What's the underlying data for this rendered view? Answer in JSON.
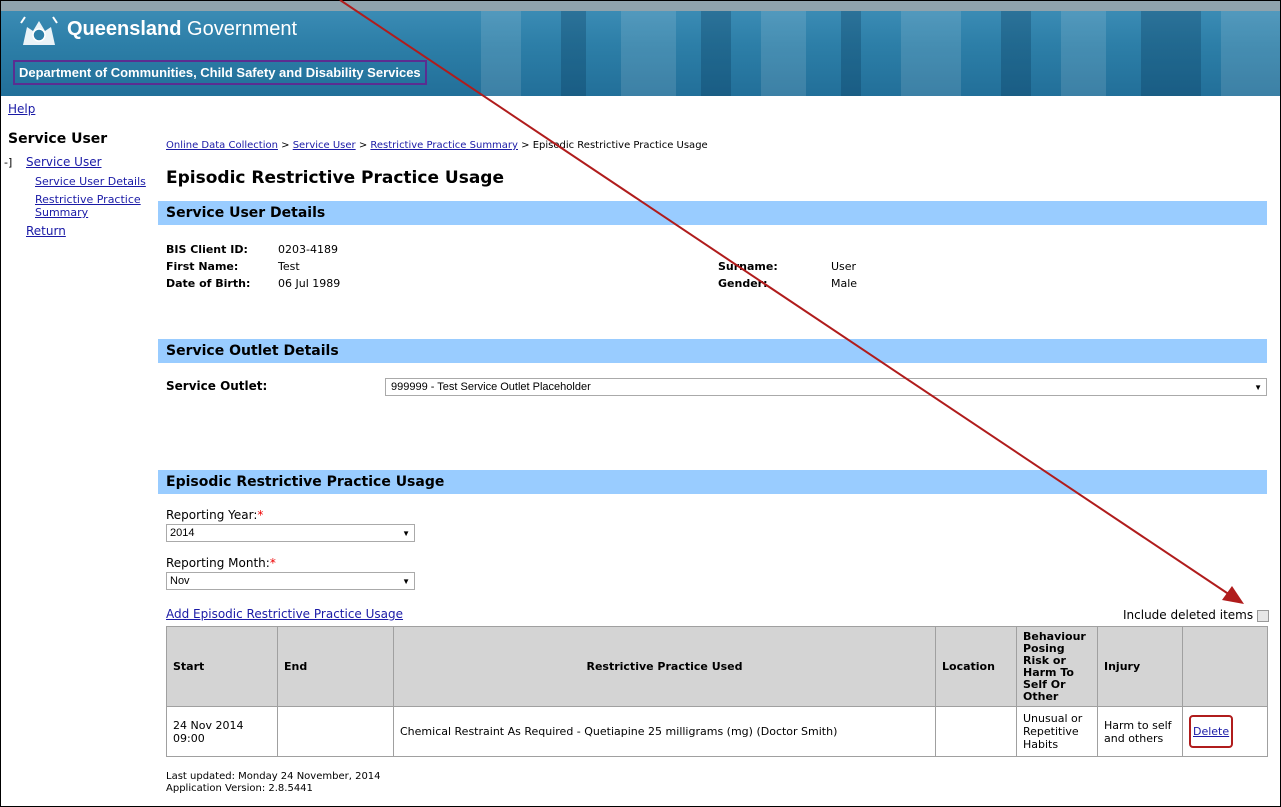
{
  "header": {
    "brand_bold": "Queensland",
    "brand_rest": " Government",
    "department": "Department of Communities, Child Safety and Disability Services"
  },
  "sidebar": {
    "help": "Help",
    "title": "Service User",
    "toggle": "-]",
    "items": [
      {
        "label": "Service User"
      },
      {
        "label": "Service User Details"
      },
      {
        "label": "Restrictive Practice Summary"
      },
      {
        "label": "Return"
      }
    ]
  },
  "breadcrumb": {
    "items": [
      "Online Data Collection",
      "Service User",
      "Restrictive Practice Summary"
    ],
    "separator": " > ",
    "current": "Episodic Restrictive Practice Usage"
  },
  "page_title": "Episodic Restrictive Practice Usage",
  "service_user_details": {
    "heading": "Service User Details",
    "bis_label": "BIS Client ID:",
    "bis_value": "0203-4189",
    "first_label": "First Name:",
    "first_value": "Test",
    "surname_label": "Surname:",
    "surname_value": "User",
    "dob_label": "Date of Birth:",
    "dob_value": "06 Jul 1989",
    "gender_label": "Gender:",
    "gender_value": "Male"
  },
  "service_outlet": {
    "heading": "Service Outlet Details",
    "label": "Service Outlet:",
    "value": "999999 - Test Service Outlet Placeholder"
  },
  "usage": {
    "heading": "Episodic Restrictive Practice Usage",
    "year_label": "Reporting Year:",
    "year_value": "2014",
    "month_label": "Reporting Month:",
    "month_value": "Nov",
    "required_mark": "*",
    "add_link": "Add Episodic Restrictive Practice Usage",
    "include_deleted": "Include deleted items",
    "columns": [
      "Start",
      "End",
      "Restrictive Practice Used",
      "Location",
      "Behaviour Posing Risk or Harm To Self Or Other",
      "Injury",
      ""
    ],
    "rows": [
      {
        "start": "24 Nov 2014 09:00",
        "end": "",
        "practice": "Chemical Restraint As Required - Quetiapine 25 milligrams (mg) (Doctor Smith)",
        "location": "",
        "behaviour": "Unusual or Repetitive Habits",
        "injury": "Harm to self and others",
        "action": "Delete"
      }
    ]
  },
  "footer": {
    "last_updated": "Last updated: Monday 24 November, 2014",
    "version": "Application Version: 2.8.5441"
  },
  "colors": {
    "section_bg": "#99ccff",
    "link": "#1a1aa6",
    "annotation": "#b01c1c",
    "header_bg": "#2d7fa8"
  }
}
